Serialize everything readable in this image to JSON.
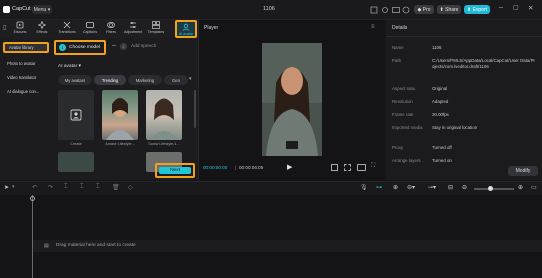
{
  "app": {
    "name": "CapCut",
    "menu_label": "Menu",
    "project_title": "1106",
    "pro_label": "Pro",
    "share_label": "Share",
    "export_label": "Export"
  },
  "toolbar": {
    "items": [
      {
        "label": "Elsouns",
        "icon": "media-icon"
      },
      {
        "label": "Effects",
        "icon": "effects-icon"
      },
      {
        "label": "Transitions",
        "icon": "transitions-icon"
      },
      {
        "label": "Captions",
        "icon": "captions-icon"
      },
      {
        "label": "Filters",
        "icon": "filters-icon"
      },
      {
        "label": "Adjustment",
        "icon": "adjustment-icon"
      },
      {
        "label": "Templates",
        "icon": "templates-icon"
      },
      {
        "label": "AI avatar",
        "icon": "ai-avatar-icon"
      }
    ]
  },
  "leftnav": {
    "items": [
      "Avatar library",
      "Photo to avatar",
      "Video translator",
      "AI dialogue con..."
    ]
  },
  "content": {
    "choose_model": "Choose model",
    "add_speech": "Add speech",
    "step1": "1",
    "step2": "2",
    "dropdown": "AI avatar",
    "tabs": [
      "My avatars",
      "Trending",
      "Marketing",
      "Gen"
    ],
    "cards": [
      {
        "caption": "Create"
      },
      {
        "caption": "Amara·Lifestyle..."
      },
      {
        "caption": "Sonia·Lifestyle-1..."
      }
    ],
    "next_label": "Next"
  },
  "player": {
    "title": "Player",
    "current_time": "00:00:00:00",
    "duration": "00:00:06:05"
  },
  "details": {
    "title": "Details",
    "rows": [
      {
        "label": "Name",
        "value": "1106"
      },
      {
        "label": "Path",
        "value": "C:/Users/PMLS/AppData/Local/CapCut/User Data/Projects/com.lveditor.draft/1106"
      },
      {
        "label": "Aspect ratio",
        "value": "Original"
      },
      {
        "label": "Resolution",
        "value": "Adapted"
      },
      {
        "label": "Frame rate",
        "value": "30.00fps"
      },
      {
        "label": "Imported media",
        "value": "Stay in original location"
      },
      {
        "label": "Proxy",
        "value": "Turned off"
      },
      {
        "label": "Arrange layers",
        "value": "Turned on"
      }
    ],
    "modify_label": "Modify"
  },
  "timeline": {
    "drop_hint": "Drag material here and start to create"
  },
  "colors": {
    "accent": "#f0a21c",
    "cyan": "#22c5d6",
    "export_blue": "#1fb8d6"
  }
}
